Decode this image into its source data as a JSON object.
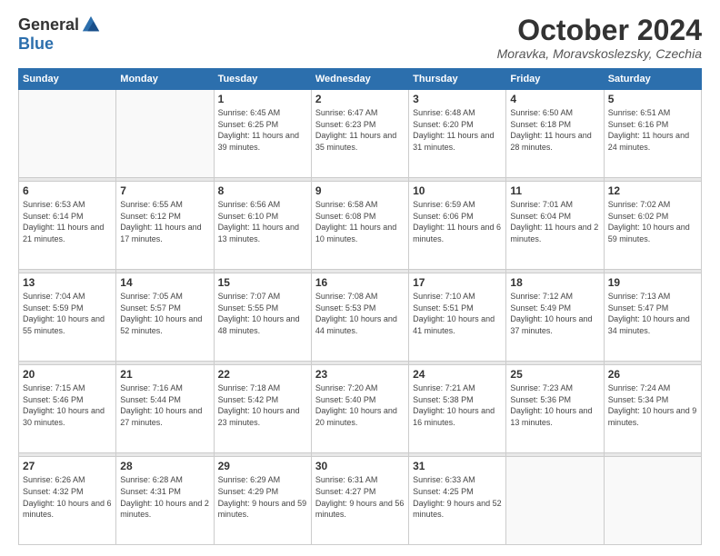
{
  "logo": {
    "general": "General",
    "blue": "Blue"
  },
  "title": "October 2024",
  "location": "Moravka, Moravskoslezsky, Czechia",
  "weekdays": [
    "Sunday",
    "Monday",
    "Tuesday",
    "Wednesday",
    "Thursday",
    "Friday",
    "Saturday"
  ],
  "weeks": [
    [
      {
        "day": "",
        "info": ""
      },
      {
        "day": "",
        "info": ""
      },
      {
        "day": "1",
        "info": "Sunrise: 6:45 AM\nSunset: 6:25 PM\nDaylight: 11 hours and 39 minutes."
      },
      {
        "day": "2",
        "info": "Sunrise: 6:47 AM\nSunset: 6:23 PM\nDaylight: 11 hours and 35 minutes."
      },
      {
        "day": "3",
        "info": "Sunrise: 6:48 AM\nSunset: 6:20 PM\nDaylight: 11 hours and 31 minutes."
      },
      {
        "day": "4",
        "info": "Sunrise: 6:50 AM\nSunset: 6:18 PM\nDaylight: 11 hours and 28 minutes."
      },
      {
        "day": "5",
        "info": "Sunrise: 6:51 AM\nSunset: 6:16 PM\nDaylight: 11 hours and 24 minutes."
      }
    ],
    [
      {
        "day": "6",
        "info": "Sunrise: 6:53 AM\nSunset: 6:14 PM\nDaylight: 11 hours and 21 minutes."
      },
      {
        "day": "7",
        "info": "Sunrise: 6:55 AM\nSunset: 6:12 PM\nDaylight: 11 hours and 17 minutes."
      },
      {
        "day": "8",
        "info": "Sunrise: 6:56 AM\nSunset: 6:10 PM\nDaylight: 11 hours and 13 minutes."
      },
      {
        "day": "9",
        "info": "Sunrise: 6:58 AM\nSunset: 6:08 PM\nDaylight: 11 hours and 10 minutes."
      },
      {
        "day": "10",
        "info": "Sunrise: 6:59 AM\nSunset: 6:06 PM\nDaylight: 11 hours and 6 minutes."
      },
      {
        "day": "11",
        "info": "Sunrise: 7:01 AM\nSunset: 6:04 PM\nDaylight: 11 hours and 2 minutes."
      },
      {
        "day": "12",
        "info": "Sunrise: 7:02 AM\nSunset: 6:02 PM\nDaylight: 10 hours and 59 minutes."
      }
    ],
    [
      {
        "day": "13",
        "info": "Sunrise: 7:04 AM\nSunset: 5:59 PM\nDaylight: 10 hours and 55 minutes."
      },
      {
        "day": "14",
        "info": "Sunrise: 7:05 AM\nSunset: 5:57 PM\nDaylight: 10 hours and 52 minutes."
      },
      {
        "day": "15",
        "info": "Sunrise: 7:07 AM\nSunset: 5:55 PM\nDaylight: 10 hours and 48 minutes."
      },
      {
        "day": "16",
        "info": "Sunrise: 7:08 AM\nSunset: 5:53 PM\nDaylight: 10 hours and 44 minutes."
      },
      {
        "day": "17",
        "info": "Sunrise: 7:10 AM\nSunset: 5:51 PM\nDaylight: 10 hours and 41 minutes."
      },
      {
        "day": "18",
        "info": "Sunrise: 7:12 AM\nSunset: 5:49 PM\nDaylight: 10 hours and 37 minutes."
      },
      {
        "day": "19",
        "info": "Sunrise: 7:13 AM\nSunset: 5:47 PM\nDaylight: 10 hours and 34 minutes."
      }
    ],
    [
      {
        "day": "20",
        "info": "Sunrise: 7:15 AM\nSunset: 5:46 PM\nDaylight: 10 hours and 30 minutes."
      },
      {
        "day": "21",
        "info": "Sunrise: 7:16 AM\nSunset: 5:44 PM\nDaylight: 10 hours and 27 minutes."
      },
      {
        "day": "22",
        "info": "Sunrise: 7:18 AM\nSunset: 5:42 PM\nDaylight: 10 hours and 23 minutes."
      },
      {
        "day": "23",
        "info": "Sunrise: 7:20 AM\nSunset: 5:40 PM\nDaylight: 10 hours and 20 minutes."
      },
      {
        "day": "24",
        "info": "Sunrise: 7:21 AM\nSunset: 5:38 PM\nDaylight: 10 hours and 16 minutes."
      },
      {
        "day": "25",
        "info": "Sunrise: 7:23 AM\nSunset: 5:36 PM\nDaylight: 10 hours and 13 minutes."
      },
      {
        "day": "26",
        "info": "Sunrise: 7:24 AM\nSunset: 5:34 PM\nDaylight: 10 hours and 9 minutes."
      }
    ],
    [
      {
        "day": "27",
        "info": "Sunrise: 6:26 AM\nSunset: 4:32 PM\nDaylight: 10 hours and 6 minutes."
      },
      {
        "day": "28",
        "info": "Sunrise: 6:28 AM\nSunset: 4:31 PM\nDaylight: 10 hours and 2 minutes."
      },
      {
        "day": "29",
        "info": "Sunrise: 6:29 AM\nSunset: 4:29 PM\nDaylight: 9 hours and 59 minutes."
      },
      {
        "day": "30",
        "info": "Sunrise: 6:31 AM\nSunset: 4:27 PM\nDaylight: 9 hours and 56 minutes."
      },
      {
        "day": "31",
        "info": "Sunrise: 6:33 AM\nSunset: 4:25 PM\nDaylight: 9 hours and 52 minutes."
      },
      {
        "day": "",
        "info": ""
      },
      {
        "day": "",
        "info": ""
      }
    ]
  ]
}
